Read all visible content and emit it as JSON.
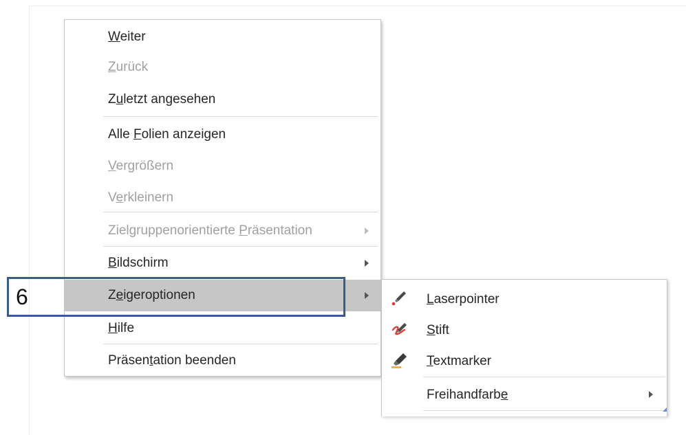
{
  "menu": {
    "items": [
      {
        "pre": "",
        "u": "W",
        "post": "eiter",
        "disabled": false
      },
      {
        "pre": "",
        "u": "Z",
        "post": "urück",
        "disabled": true
      },
      {
        "pre": "Z",
        "u": "u",
        "post": "letzt angesehen",
        "disabled": false
      },
      {
        "pre": "Alle ",
        "u": "F",
        "post": "olien anzeigen",
        "disabled": false
      },
      {
        "pre": "",
        "u": "V",
        "post": "ergrößern",
        "disabled": true
      },
      {
        "pre": "V",
        "u": "e",
        "post": "rkleinern",
        "disabled": true
      },
      {
        "pre": "Zielgruppenorientierte ",
        "u": "P",
        "post": "räsentation",
        "disabled": true
      },
      {
        "pre": "",
        "u": "B",
        "post": "ildschirm",
        "disabled": false
      },
      {
        "pre": "Z",
        "u": "e",
        "post": "igeroptionen",
        "disabled": false
      },
      {
        "pre": "",
        "u": "H",
        "post": "ilfe",
        "disabled": false
      },
      {
        "pre": "Präsen",
        "u": "t",
        "post": "ation beenden",
        "disabled": false
      }
    ]
  },
  "submenu": {
    "items": [
      {
        "pre": "",
        "u": "L",
        "post": "aserpointer",
        "icon": "laser-pointer-icon"
      },
      {
        "pre": "",
        "u": "S",
        "post": "tift",
        "icon": "pen-icon"
      },
      {
        "pre": "",
        "u": "T",
        "post": "extmarker",
        "icon": "highlighter-icon"
      },
      {
        "pre": "Freihandfarb",
        "u": "e",
        "post": "",
        "icon": ""
      }
    ]
  },
  "callout": {
    "number": "6"
  },
  "colors": {
    "highlight": "#c6c6c6",
    "callout_border": "#3a5a94",
    "disabled_text": "#a0a0a0"
  }
}
